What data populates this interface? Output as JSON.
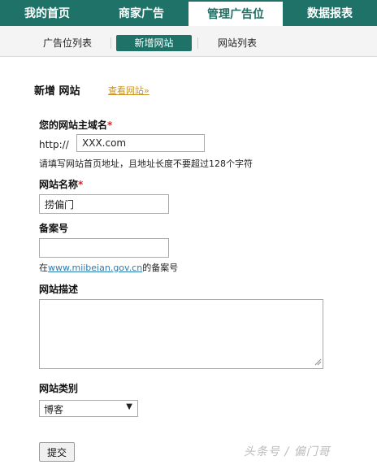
{
  "topnav": {
    "tabs": [
      {
        "label": "我的首页"
      },
      {
        "label": "商家广告"
      },
      {
        "label": "管理广告位"
      },
      {
        "label": "数据报表"
      }
    ]
  },
  "subnav": {
    "items": [
      {
        "label": "广告位列表"
      },
      {
        "label": "新增网站"
      },
      {
        "label": "网站列表"
      }
    ]
  },
  "page": {
    "heading": "新增 网站",
    "view_link": "查看网站»"
  },
  "form": {
    "domain": {
      "label": "您的网站主域名",
      "required": "*",
      "prefix": "http://",
      "value": "XXX.com",
      "hint": "请填写网站首页地址，且地址长度不要超过128个字符"
    },
    "name": {
      "label": "网站名称",
      "required": "*",
      "value": "捞偏门"
    },
    "icp": {
      "label": "备案号",
      "value": "",
      "hint_prefix": "在",
      "hint_link": "www.miibeian.gov.cn",
      "hint_suffix": "的备案号"
    },
    "description": {
      "label": "网站描述",
      "value": ""
    },
    "category": {
      "label": "网站类别",
      "selected": "博客"
    },
    "submit_label": "提交"
  },
  "watermark": "头条号 / 偏门哥"
}
